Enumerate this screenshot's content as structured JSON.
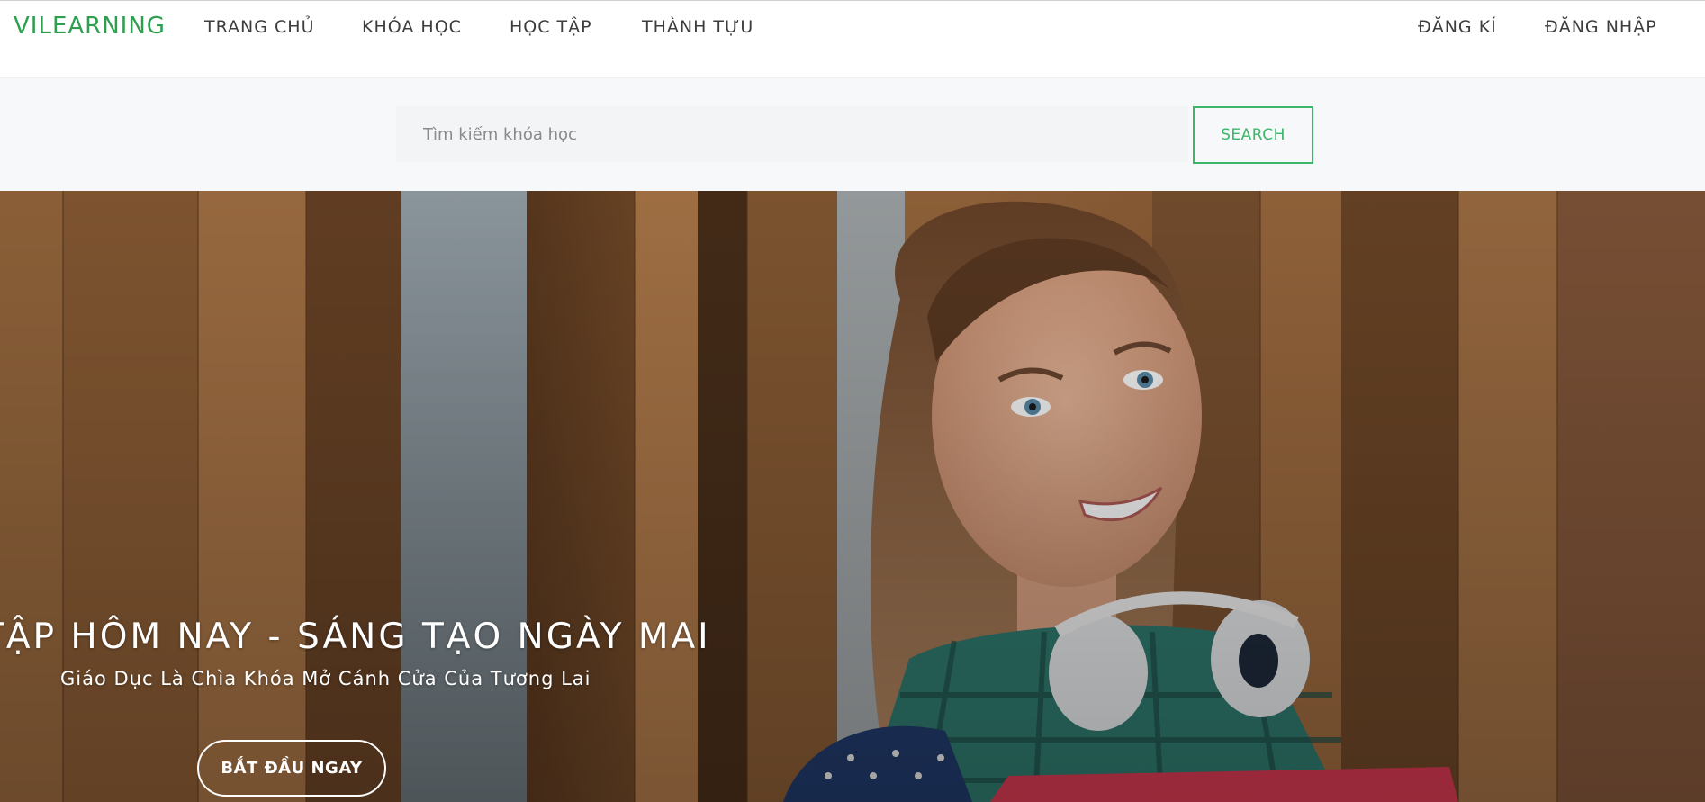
{
  "header": {
    "brand": "VILEARNING",
    "nav": [
      "TRANG CHỦ",
      "KHÓA HỌC",
      "HỌC TẬP",
      "THÀNH TỰU"
    ],
    "auth": [
      "ĐĂNG KÍ",
      "ĐĂNG NHẬP"
    ]
  },
  "search": {
    "placeholder": "Tìm kiếm khóa học",
    "value": "",
    "button_label": "SEARCH"
  },
  "hero": {
    "title": "TẬP HÔM NAY - SÁNG TẠO NGÀY MAI",
    "subtitle": "Giáo Dục Là Chìa Khóa Mở Cánh Cửa Của Tương Lai",
    "cta_label": "BẮT ĐẦU NGAY",
    "image_subject": "smiling student with headphones holding a folder"
  },
  "colors": {
    "brand": "#2e9e4f",
    "accent": "#3cb66a",
    "nav_text": "#3d3d3d",
    "search_bg": "#f7f8f9",
    "hero_text": "#ffffff"
  }
}
